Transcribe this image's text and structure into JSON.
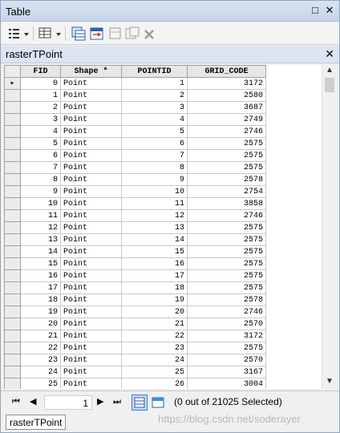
{
  "window": {
    "title": "Table"
  },
  "table_name": "rasterTPoint",
  "columns": [
    "FID",
    "Shape *",
    "POINTID",
    "GRID_CODE"
  ],
  "rows": [
    [
      "0",
      "Point",
      "1",
      "3172"
    ],
    [
      "1",
      "Point",
      "2",
      "2580"
    ],
    [
      "2",
      "Point",
      "3",
      "3687"
    ],
    [
      "3",
      "Point",
      "4",
      "2749"
    ],
    [
      "4",
      "Point",
      "5",
      "2746"
    ],
    [
      "5",
      "Point",
      "6",
      "2575"
    ],
    [
      "6",
      "Point",
      "7",
      "2575"
    ],
    [
      "7",
      "Point",
      "8",
      "2575"
    ],
    [
      "8",
      "Point",
      "9",
      "2578"
    ],
    [
      "9",
      "Point",
      "10",
      "2754"
    ],
    [
      "10",
      "Point",
      "11",
      "3858"
    ],
    [
      "11",
      "Point",
      "12",
      "2746"
    ],
    [
      "12",
      "Point",
      "13",
      "2575"
    ],
    [
      "13",
      "Point",
      "14",
      "2575"
    ],
    [
      "14",
      "Point",
      "15",
      "2575"
    ],
    [
      "15",
      "Point",
      "16",
      "2575"
    ],
    [
      "16",
      "Point",
      "17",
      "2575"
    ],
    [
      "17",
      "Point",
      "18",
      "2575"
    ],
    [
      "18",
      "Point",
      "19",
      "2578"
    ],
    [
      "19",
      "Point",
      "20",
      "2746"
    ],
    [
      "20",
      "Point",
      "21",
      "2570"
    ],
    [
      "21",
      "Point",
      "22",
      "3172"
    ],
    [
      "22",
      "Point",
      "23",
      "2575"
    ],
    [
      "23",
      "Point",
      "24",
      "2570"
    ],
    [
      "24",
      "Point",
      "25",
      "3167"
    ],
    [
      "25",
      "Point",
      "26",
      "3004"
    ]
  ],
  "nav": {
    "record": "1",
    "status": "(0 out of 21025 Selected)"
  },
  "bottom_tab": "rasterTPoint",
  "watermark": "https://blog.csdn.net/soderayer",
  "icons": {
    "maximize": "□",
    "close": "✕",
    "first": "⏮",
    "prev": "◀",
    "next": "▶",
    "last": "⏭",
    "current_row": "▸",
    "scroll_up": "▲",
    "scroll_down": "▼"
  },
  "colors": {
    "accent": "#2a5ea9",
    "titlebar": "#c6d5e9"
  }
}
